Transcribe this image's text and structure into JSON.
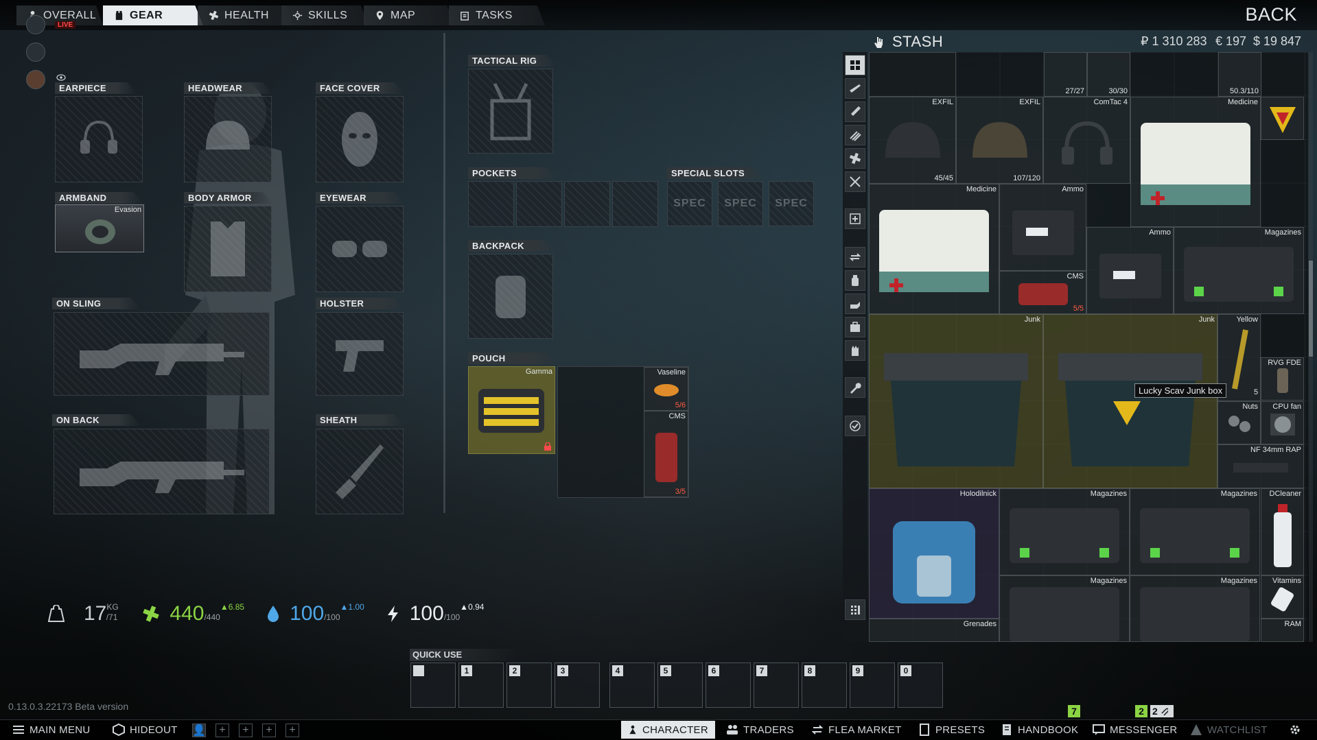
{
  "tabs": [
    {
      "label": "OVERALL",
      "icon": "person-icon"
    },
    {
      "label": "GEAR",
      "icon": "vest-icon"
    },
    {
      "label": "HEALTH",
      "icon": "health-icon"
    },
    {
      "label": "SKILLS",
      "icon": "skills-icon"
    },
    {
      "label": "MAP",
      "icon": "map-pin-icon"
    },
    {
      "label": "TASKS",
      "icon": "tasks-icon"
    }
  ],
  "back_label": "BACK",
  "live_label": "LIVE",
  "slots": {
    "earpiece": "EARPIECE",
    "headwear": "HEADWEAR",
    "face_cover": "FACE COVER",
    "armband": "ARMBAND",
    "body_armor": "BODY ARMOR",
    "eyewear": "EYEWEAR",
    "on_sling": "ON SLING",
    "holster": "HOLSTER",
    "on_back": "ON BACK",
    "sheath": "SHEATH",
    "tactical_rig": "TACTICAL RIG",
    "pockets": "POCKETS",
    "special_slots": "SPECIAL SLOTS",
    "backpack": "BACKPACK",
    "pouch": "POUCH"
  },
  "armband_item": "Evasion",
  "special_slot_text": "SPEC",
  "pouch_item": "Gamma",
  "pouch_contents": [
    {
      "name": "Vaseline",
      "count": "5/6"
    },
    {
      "name": "CMS",
      "count": "3/5"
    }
  ],
  "stats": {
    "weight": "17",
    "weight_unit": "KG",
    "weight_max": "/71",
    "health": "440",
    "health_max": "/440",
    "health_delta": "6.85",
    "hydration": "100",
    "hydration_max": "/100",
    "hydration_delta": "1.00",
    "energy": "100",
    "energy_max": "/100",
    "energy_delta": "0.94"
  },
  "stash": {
    "title": "STASH",
    "roubles": "₽ 1 310 283",
    "euros": "€ 197",
    "dollars": "$ 19 847",
    "items": [
      {
        "name": "",
        "count": "27/27"
      },
      {
        "name": "",
        "count": "30/30"
      },
      {
        "name": "",
        "count": "50.3/110"
      },
      {
        "name": "EXFIL",
        "count": "45/45"
      },
      {
        "name": "EXFIL",
        "count": "107/120"
      },
      {
        "name": "ComTac 4",
        "count": ""
      },
      {
        "name": "Medicine",
        "count": ""
      },
      {
        "name": "Medicine",
        "count": ""
      },
      {
        "name": "Ammo",
        "count": ""
      },
      {
        "name": "Ammo",
        "count": ""
      },
      {
        "name": "Magazines",
        "count": ""
      },
      {
        "name": "CMS",
        "count": "5/5"
      },
      {
        "name": "Junk",
        "count": ""
      },
      {
        "name": "Junk",
        "count": ""
      },
      {
        "name": "Yellow",
        "count": ""
      },
      {
        "name": "RVG FDE",
        "count": ""
      },
      {
        "name": "Nuts",
        "count": ""
      },
      {
        "name": "CPU fan",
        "count": ""
      },
      {
        "name": "NF 34mm RAP",
        "count": ""
      },
      {
        "name": "Holodilnick",
        "count": ""
      },
      {
        "name": "Magazines",
        "count": ""
      },
      {
        "name": "Magazines",
        "count": ""
      },
      {
        "name": "DCleaner",
        "count": ""
      },
      {
        "name": "Magazines",
        "count": ""
      },
      {
        "name": "Magazines",
        "count": ""
      },
      {
        "name": "Vitamins",
        "count": ""
      },
      {
        "name": "Grenades",
        "count": ""
      },
      {
        "name": "RAM",
        "count": ""
      }
    ],
    "tooltip": "Lucky Scav Junk box",
    "tooltip_side": "5"
  },
  "quick_use": {
    "label": "QUICK USE",
    "keys": [
      "",
      "1",
      "2",
      "3",
      "4",
      "5",
      "6",
      "7",
      "8",
      "9",
      "0"
    ]
  },
  "version": "0.13.0.3.22173 Beta version",
  "bottom": {
    "main_menu": "MAIN MENU",
    "hideout": "HIDEOUT",
    "character": "CHARACTER",
    "traders": "TRADERS",
    "flea_market": "FLEA MARKET",
    "presets": "PRESETS",
    "handbook": "HANDBOOK",
    "messenger": "MESSENGER",
    "watchlist": "WATCHLIST",
    "badge_handbook": "7",
    "badge_msg1": "2",
    "badge_msg2": "2"
  },
  "colors": {
    "accent_green": "#8bd444",
    "health_green": "#8bd444",
    "hydration_blue": "#4fa8e8",
    "energy_white": "#e8ecee",
    "junk_yellow": "#5f5c28"
  }
}
